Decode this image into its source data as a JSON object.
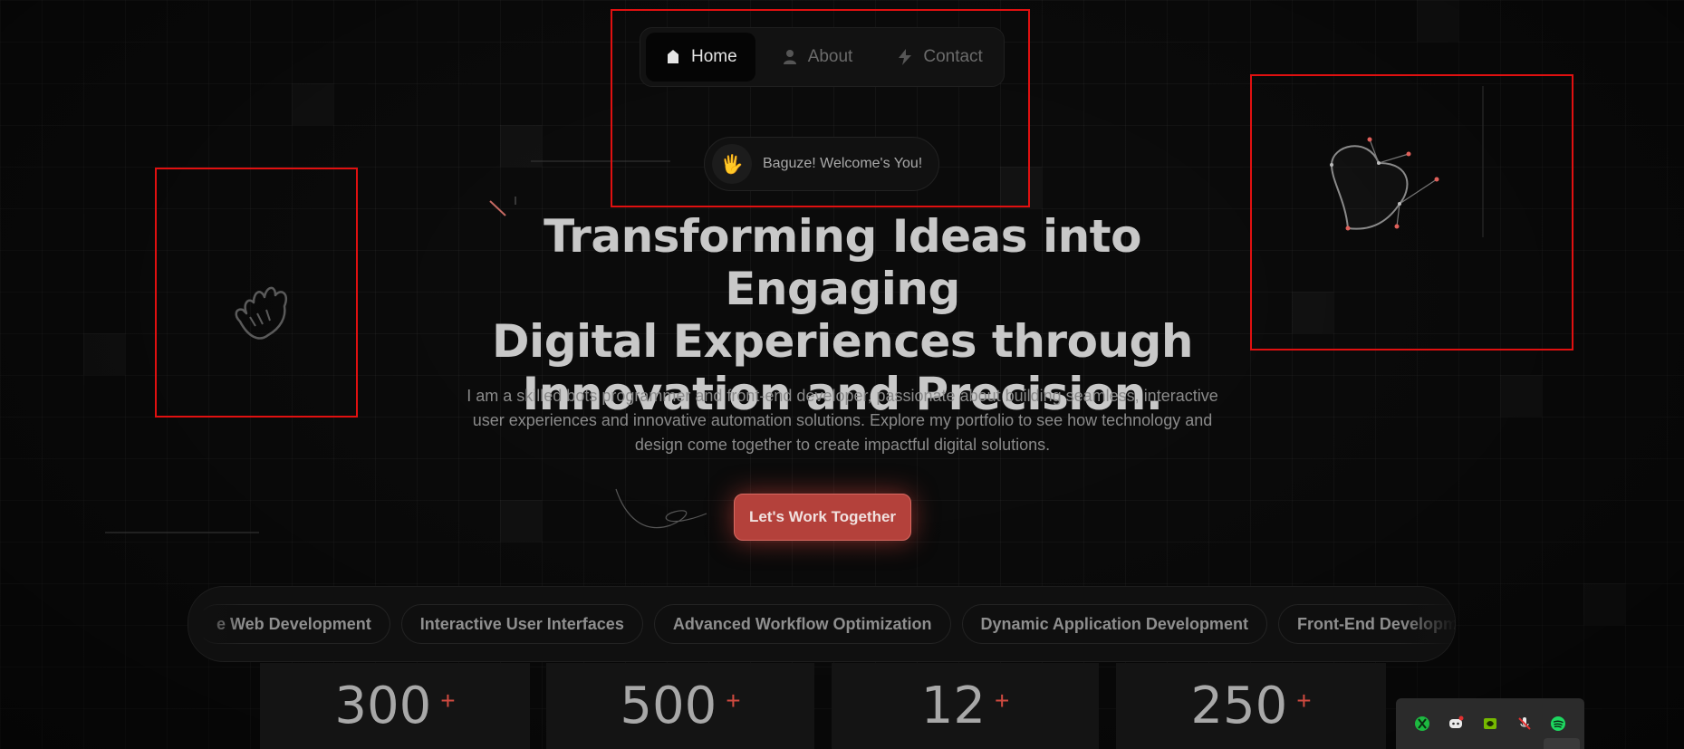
{
  "nav": {
    "items": [
      {
        "label": "Home",
        "icon": "home-icon",
        "active": true
      },
      {
        "label": "About",
        "icon": "person-icon",
        "active": false
      },
      {
        "label": "Contact",
        "icon": "bolt-icon",
        "active": false
      }
    ]
  },
  "welcome": {
    "emoji": "🖐",
    "text": "Baguze! Welcome's You!"
  },
  "hero": {
    "title_line1": "Transforming Ideas into Engaging",
    "title_line2": "Digital Experiences through",
    "title_line3": "Innovation and Precision.",
    "description": "I am a skilled bots programmer and front-end developer, passionate about building seamless, interactive user experiences and innovative automation solutions. Explore my portfolio to see how technology and design come together to create impactful digital solutions.",
    "cta_label": "Let's Work Together"
  },
  "skills": [
    "e Web Development",
    "Interactive User Interfaces",
    "Advanced Workflow Optimization",
    "Dynamic Application Development",
    "Front-End Development"
  ],
  "stats": [
    {
      "value": "300",
      "suffix": "+"
    },
    {
      "value": "500",
      "suffix": "+"
    },
    {
      "value": "12",
      "suffix": "+"
    },
    {
      "value": "250",
      "suffix": "+"
    }
  ],
  "tray": [
    "xbox-icon",
    "discord-icon",
    "nvidia-icon",
    "mic-muted-icon",
    "spotify-icon"
  ],
  "colors": {
    "accent": "#b4413b",
    "highlight_box": "#e01010",
    "background": "#0b0b0b"
  }
}
